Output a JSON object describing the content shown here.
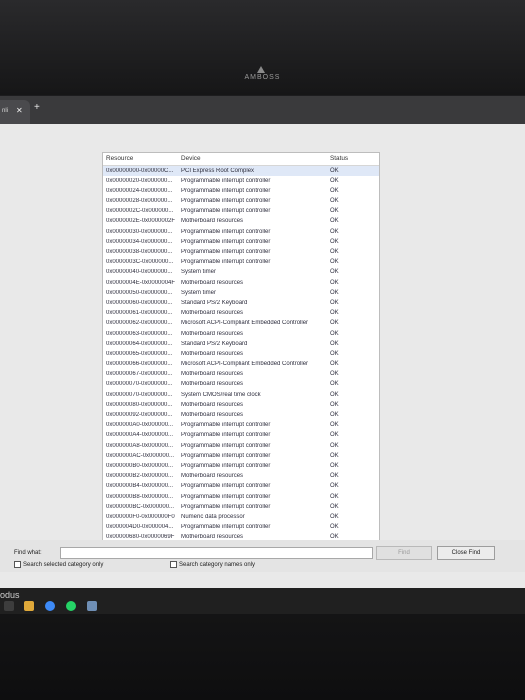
{
  "brand": "AMBOSS",
  "browser": {
    "tab_label": "nli",
    "close_glyph": "✕",
    "new_tab_glyph": "+"
  },
  "columns": {
    "resource": "Resource",
    "device": "Device",
    "status": "Status"
  },
  "rows": [
    {
      "resource": "0x00000000-0x00000C...",
      "device": "PCI Express Root Complex",
      "status": "OK"
    },
    {
      "resource": "0x00000020-0x000000...",
      "device": "Programmable interrupt controller",
      "status": "OK"
    },
    {
      "resource": "0x00000024-0x000000...",
      "device": "Programmable interrupt controller",
      "status": "OK"
    },
    {
      "resource": "0x00000028-0x000000...",
      "device": "Programmable interrupt controller",
      "status": "OK"
    },
    {
      "resource": "0x0000002C-0x000000...",
      "device": "Programmable interrupt controller",
      "status": "OK"
    },
    {
      "resource": "0x0000002E-0x0000002F",
      "device": "Motherboard resources",
      "status": "OK"
    },
    {
      "resource": "0x00000030-0x000000...",
      "device": "Programmable interrupt controller",
      "status": "OK"
    },
    {
      "resource": "0x00000034-0x000000...",
      "device": "Programmable interrupt controller",
      "status": "OK"
    },
    {
      "resource": "0x00000038-0x000000...",
      "device": "Programmable interrupt controller",
      "status": "OK"
    },
    {
      "resource": "0x0000003C-0x000000...",
      "device": "Programmable interrupt controller",
      "status": "OK"
    },
    {
      "resource": "0x00000040-0x000000...",
      "device": "System timer",
      "status": "OK"
    },
    {
      "resource": "0x0000004E-0x0000004F",
      "device": "Motherboard resources",
      "status": "OK"
    },
    {
      "resource": "0x00000050-0x000000...",
      "device": "System timer",
      "status": "OK"
    },
    {
      "resource": "0x00000060-0x000000...",
      "device": "Standard PS/2 Keyboard",
      "status": "OK"
    },
    {
      "resource": "0x00000061-0x000000...",
      "device": "Motherboard resources",
      "status": "OK"
    },
    {
      "resource": "0x00000062-0x000000...",
      "device": "Microsoft ACPI-Compliant Embedded Controller",
      "status": "OK"
    },
    {
      "resource": "0x00000063-0x000000...",
      "device": "Motherboard resources",
      "status": "OK"
    },
    {
      "resource": "0x00000064-0x000000...",
      "device": "Standard PS/2 Keyboard",
      "status": "OK"
    },
    {
      "resource": "0x00000065-0x000000...",
      "device": "Motherboard resources",
      "status": "OK"
    },
    {
      "resource": "0x00000066-0x000000...",
      "device": "Microsoft ACPI-Compliant Embedded Controller",
      "status": "OK"
    },
    {
      "resource": "0x00000067-0x000000...",
      "device": "Motherboard resources",
      "status": "OK"
    },
    {
      "resource": "0x00000070-0x000000...",
      "device": "Motherboard resources",
      "status": "OK"
    },
    {
      "resource": "0x00000070-0x000000...",
      "device": "System CMOS/real time clock",
      "status": "OK"
    },
    {
      "resource": "0x00000080-0x000000...",
      "device": "Motherboard resources",
      "status": "OK"
    },
    {
      "resource": "0x00000092-0x000000...",
      "device": "Motherboard resources",
      "status": "OK"
    },
    {
      "resource": "0x000000A0-0x000000...",
      "device": "Programmable interrupt controller",
      "status": "OK"
    },
    {
      "resource": "0x000000A4-0x000000...",
      "device": "Programmable interrupt controller",
      "status": "OK"
    },
    {
      "resource": "0x000000A8-0x000000...",
      "device": "Programmable interrupt controller",
      "status": "OK"
    },
    {
      "resource": "0x000000AC-0x000000...",
      "device": "Programmable interrupt controller",
      "status": "OK"
    },
    {
      "resource": "0x000000B0-0x000000...",
      "device": "Programmable interrupt controller",
      "status": "OK"
    },
    {
      "resource": "0x000000B2-0x000000...",
      "device": "Motherboard resources",
      "status": "OK"
    },
    {
      "resource": "0x000000B4-0x000000...",
      "device": "Programmable interrupt controller",
      "status": "OK"
    },
    {
      "resource": "0x000000B8-0x000000...",
      "device": "Programmable interrupt controller",
      "status": "OK"
    },
    {
      "resource": "0x000000BC-0x000000...",
      "device": "Programmable interrupt controller",
      "status": "OK"
    },
    {
      "resource": "0x000000F0-0x000000F0",
      "device": "Numeric data processor",
      "status": "OK"
    },
    {
      "resource": "0x000004D0-0x000004...",
      "device": "Programmable interrupt controller",
      "status": "OK"
    },
    {
      "resource": "0x00000680-0x0000069F",
      "device": "Motherboard resources",
      "status": "OK"
    },
    {
      "resource": "0x00000D00-0x0000FFFF",
      "device": "PCI Express Root Complex",
      "status": "OK"
    }
  ],
  "find": {
    "label": "Find what:",
    "value": "",
    "find_button": "Find",
    "close_button": "Close Find",
    "option_selected_category": "Search selected category only",
    "option_category_names": "Search category names only"
  },
  "taskbar": {
    "text": "odus"
  },
  "colors": {
    "selection": "#dfe8f7",
    "taskbar": "#202020"
  }
}
